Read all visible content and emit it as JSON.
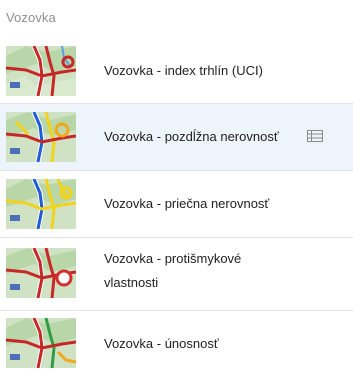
{
  "section": {
    "title": "Vozovka"
  },
  "items": [
    {
      "label": "Vozovka - index trhlín (UCI)"
    },
    {
      "label": "Vozovka - pozdĺžna nerovnosť",
      "action_icon": "list-icon"
    },
    {
      "label": "Vozovka - priečna nerovnosť"
    },
    {
      "label": "Vozovka - protišmykové vlastnosti"
    },
    {
      "label": "Vozovka - únosnosť"
    }
  ]
}
